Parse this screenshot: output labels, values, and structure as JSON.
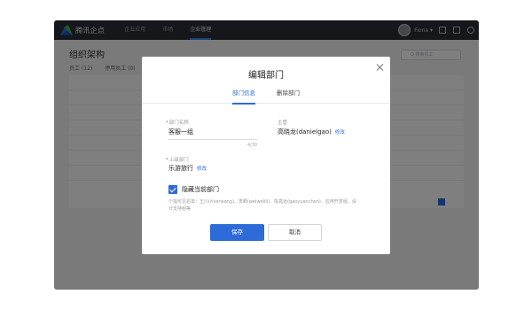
{
  "app": {
    "brand": "腾讯企点",
    "nav": [
      "企业应用",
      "市场",
      "企业管理"
    ],
    "user_name": "Fiona ▾"
  },
  "background_page": {
    "title": "组织架构",
    "tabs": [
      "员工 (12)",
      "停用员工 (0)"
    ],
    "search_placeholder": "Q 搜索员工"
  },
  "modal": {
    "title": "编辑部门",
    "tabs": [
      "部门信息",
      "删除部门"
    ],
    "dept_name_label": "部门名称",
    "dept_name_value": "客服一组",
    "dept_name_counter": "4/30",
    "manager_label": "主管",
    "manager_value": "高晓龙(danielgao)",
    "manager_edit": "修改",
    "parent_label": "上级部门",
    "parent_value": "乐游旅行",
    "parent_edit": "修改",
    "hide_label": "隐藏当前部门",
    "hide_checked": true,
    "hint_text": "个指可见名单：王川(riverwang)、李卿(weiwelili)、陈高远(gaoyuanchen)、应用开发组、设计支持组等",
    "save_label": "保存",
    "cancel_label": "取消"
  }
}
